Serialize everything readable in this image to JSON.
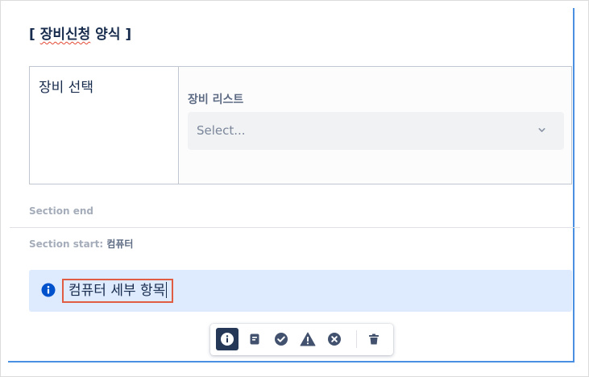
{
  "form": {
    "title_open": "[ ",
    "title_main": "장비신청",
    "title_rest": " 양식 ]"
  },
  "table": {
    "row_label": "장비 선택",
    "field_label": "장비 리스트",
    "select_placeholder": "Select..."
  },
  "sections": {
    "end_label": "Section end",
    "start_label": "Section start:",
    "start_name": "컴퓨터"
  },
  "panel": {
    "type": "info",
    "text": "컴퓨터 세부 항목",
    "color": "#deebff",
    "icon_color": "#0052cc"
  },
  "toolbar": {
    "buttons": [
      {
        "icon": "info-icon",
        "active": true
      },
      {
        "icon": "note-icon",
        "active": false
      },
      {
        "icon": "success-icon",
        "active": false
      },
      {
        "icon": "warning-icon",
        "active": false
      },
      {
        "icon": "error-icon",
        "active": false
      },
      {
        "icon": "delete-icon",
        "active": false
      }
    ]
  }
}
